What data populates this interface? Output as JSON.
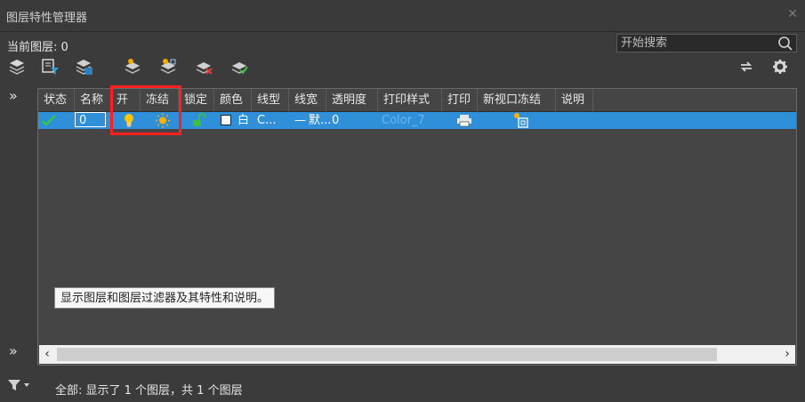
{
  "window": {
    "title": "图层特性管理器",
    "close_icon": "close-icon"
  },
  "current_layer": {
    "label": "当前图层:",
    "value": "0"
  },
  "search": {
    "placeholder": "开始搜索"
  },
  "toolbar": {
    "buttons": [
      {
        "name": "new-property-filter-button",
        "icon": "filter-icon"
      },
      {
        "name": "new-group-filter-button",
        "icon": "group-filter-icon"
      },
      {
        "name": "layer-states-manager-button",
        "icon": "layer-states-icon"
      },
      {
        "name": "new-layer-button",
        "icon": "new-layer-icon"
      },
      {
        "name": "new-layer-vp-frozen-button",
        "icon": "new-layer-vp-icon"
      },
      {
        "name": "delete-layer-button",
        "icon": "delete-layer-icon"
      },
      {
        "name": "set-current-button",
        "icon": "set-current-icon"
      },
      {
        "name": "refresh-button",
        "icon": "refresh-icon"
      },
      {
        "name": "settings-button",
        "icon": "gear-icon"
      }
    ]
  },
  "table": {
    "columns": [
      "状态",
      "名称",
      "开",
      "冻结",
      "锁定",
      "颜色",
      "线型",
      "线宽",
      "透明度",
      "打印样式",
      "打印",
      "新视口冻结",
      "说明"
    ],
    "rows": [
      {
        "status": "current-check-icon",
        "name": "0",
        "on": "lightbulb-on-icon",
        "freeze": "sun-thawed-icon",
        "lock": "unlocked-icon",
        "color_name": "白",
        "color_hex": "#ffffff",
        "linetype": "C...",
        "lineweight_dash": "—",
        "lineweight": "默...",
        "transparency": "0",
        "plot_style": "Color_7",
        "plot": "printer-icon",
        "vp_freeze": "new-vp-freeze-icon",
        "description": ""
      }
    ]
  },
  "tooltip": {
    "text": "显示图层和图层过滤器及其特性和说明。"
  },
  "status": {
    "text": "全部: 显示了 1 个图层，共 1 个图层"
  },
  "colors": {
    "selection": "#2f8fd8",
    "highlight_box": "#ff1f1f",
    "background": "#3b3b3b"
  }
}
